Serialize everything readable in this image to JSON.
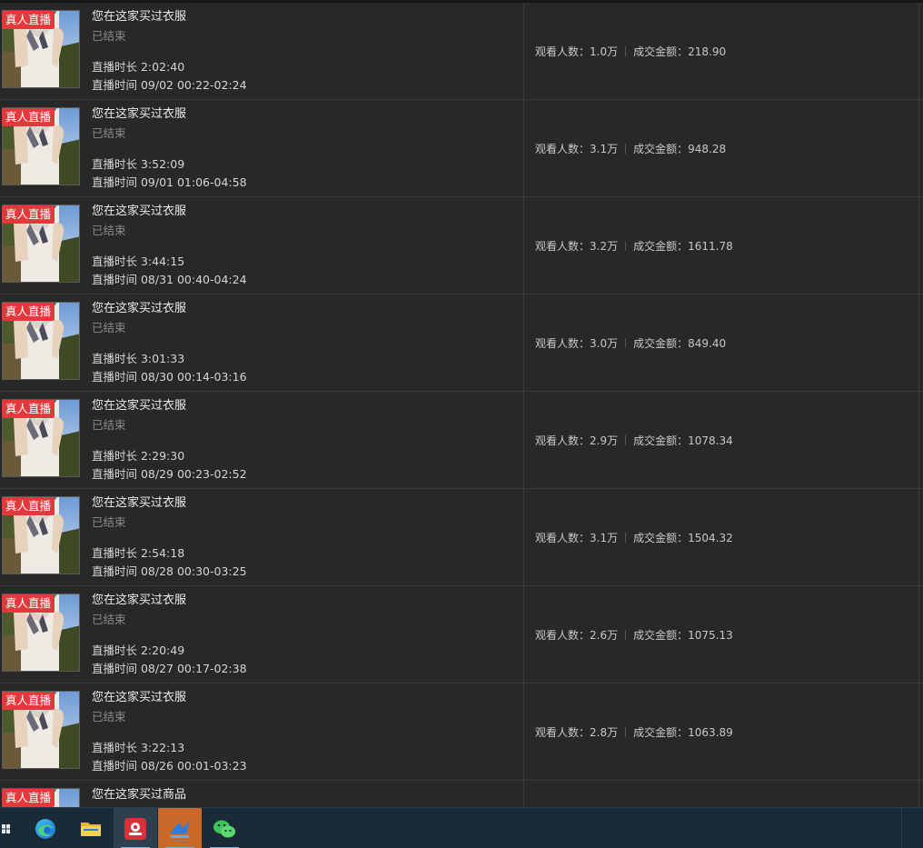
{
  "rows": [
    {
      "tag": "真人直播",
      "title": "您在这家买过衣服",
      "status": "已结束",
      "duration": "直播时长 2:02:40",
      "time": "直播时间 09/02 00:22-02:24",
      "viewers": "观看人数：1.0万",
      "sales": "成交金额：218.90"
    },
    {
      "tag": "真人直播",
      "title": "您在这家买过衣服",
      "status": "已结束",
      "duration": "直播时长 3:52:09",
      "time": "直播时间 09/01 01:06-04:58",
      "viewers": "观看人数：3.1万",
      "sales": "成交金额：948.28"
    },
    {
      "tag": "真人直播",
      "title": "您在这家买过衣服",
      "status": "已结束",
      "duration": "直播时长 3:44:15",
      "time": "直播时间 08/31 00:40-04:24",
      "viewers": "观看人数：3.2万",
      "sales": "成交金额：1611.78"
    },
    {
      "tag": "真人直播",
      "title": "您在这家买过衣服",
      "status": "已结束",
      "duration": "直播时长 3:01:33",
      "time": "直播时间 08/30 00:14-03:16",
      "viewers": "观看人数：3.0万",
      "sales": "成交金额：849.40"
    },
    {
      "tag": "真人直播",
      "title": "您在这家买过衣服",
      "status": "已结束",
      "duration": "直播时长 2:29:30",
      "time": "直播时间 08/29 00:23-02:52",
      "viewers": "观看人数：2.9万",
      "sales": "成交金额：1078.34"
    },
    {
      "tag": "真人直播",
      "title": "您在这家买过衣服",
      "status": "已结束",
      "duration": "直播时长 2:54:18",
      "time": "直播时间 08/28 00:30-03:25",
      "viewers": "观看人数：3.1万",
      "sales": "成交金额：1504.32"
    },
    {
      "tag": "真人直播",
      "title": "您在这家买过衣服",
      "status": "已结束",
      "duration": "直播时长 2:20:49",
      "time": "直播时间 08/27 00:17-02:38",
      "viewers": "观看人数：2.6万",
      "sales": "成交金额：1075.13"
    },
    {
      "tag": "真人直播",
      "title": "您在这家买过衣服",
      "status": "已结束",
      "duration": "直播时长 3:22:13",
      "time": "直播时间 08/26 00:01-03:23",
      "viewers": "观看人数：2.8万",
      "sales": "成交金额：1063.89"
    },
    {
      "tag": "真人直播",
      "title": "您在这家买过商品",
      "status": "",
      "duration": "",
      "time": "",
      "viewers": "",
      "sales": ""
    }
  ],
  "taskbar": {
    "icons": [
      "windows-start-icon",
      "edge-browser-icon",
      "file-explorer-icon",
      "red-app-icon",
      "blue-app-icon",
      "wechat-icon"
    ],
    "colors": {
      "bg": "#1a2a36",
      "active": "#2e4050",
      "accent": "#7fb0d6"
    }
  },
  "colors": {
    "row_bg": "#282828",
    "tag_bg": "#e4393c",
    "muted_text": "#8a8a8a"
  }
}
